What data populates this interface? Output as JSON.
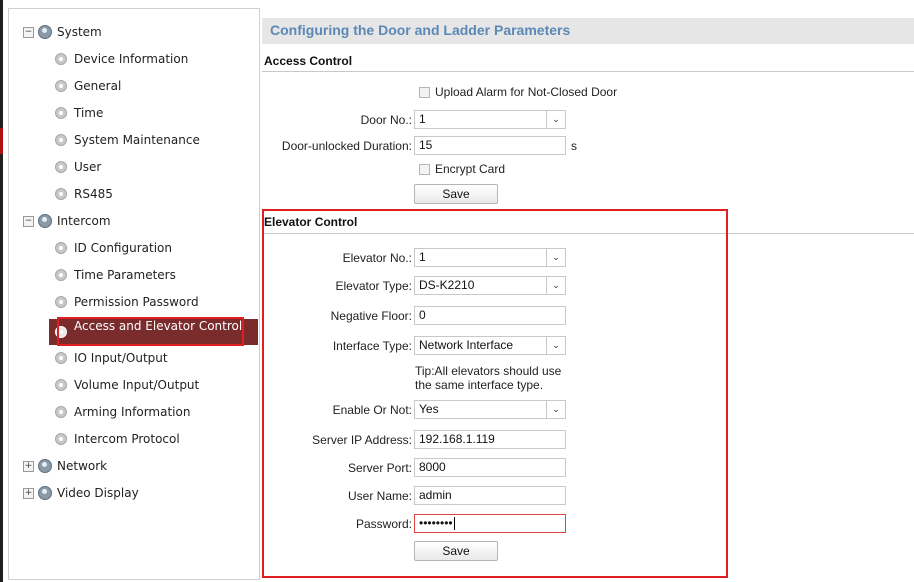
{
  "sidebar": {
    "system": {
      "label": "System",
      "toggle": "−",
      "items": [
        "Device Information",
        "General",
        "Time",
        "System Maintenance",
        "User",
        "RS485"
      ]
    },
    "intercom": {
      "label": "Intercom",
      "toggle": "−",
      "items": [
        "ID Configuration",
        "Time Parameters",
        "Permission Password",
        "Access and Elevator Control",
        "IO Input/Output",
        "Volume Input/Output",
        "Arming Information",
        "Intercom Protocol"
      ],
      "selected": "Access and Elevator Control"
    },
    "network": {
      "label": "Network",
      "toggle": "+"
    },
    "video_display": {
      "label": "Video Display",
      "toggle": "+"
    }
  },
  "page": {
    "title": "Configuring the Door and Ladder Parameters"
  },
  "access_control": {
    "section_title": "Access Control",
    "upload_alarm_label": "Upload Alarm for Not-Closed Door",
    "door_no_label": "Door No.:",
    "door_no_value": "1",
    "door_unlocked_label": "Door-unlocked Duration:",
    "door_unlocked_value": "15",
    "door_unlocked_unit": "s",
    "encrypt_card_label": "Encrypt Card",
    "save_label": "Save"
  },
  "elevator_control": {
    "section_title": "Elevator Control",
    "elevator_no_label": "Elevator No.:",
    "elevator_no_value": "1",
    "elevator_type_label": "Elevator Type:",
    "elevator_type_value": "DS-K2210",
    "negative_floor_label": "Negative Floor:",
    "negative_floor_value": "0",
    "interface_type_label": "Interface Type:",
    "interface_type_value": "Network Interface",
    "tip_line1": "Tip:All elevators should use",
    "tip_line2": "the same interface type.",
    "enable_label": "Enable Or Not:",
    "enable_value": "Yes",
    "server_ip_label": "Server IP Address:",
    "server_ip_value": "192.168.1.119",
    "server_port_label": "Server Port:",
    "server_port_value": "8000",
    "user_name_label": "User Name:",
    "user_name_value": "admin",
    "password_label": "Password:",
    "password_value": "••••••••",
    "save_label": "Save"
  },
  "colors": {
    "title_text": "#5b88b5",
    "selected_bg": "#7a2b2b",
    "highlight_outline": "#e02020"
  },
  "icons": {
    "tree_group": "globe-gear-icon",
    "tree_item": "gear-icon",
    "dropdown": "chevron-down-icon"
  }
}
